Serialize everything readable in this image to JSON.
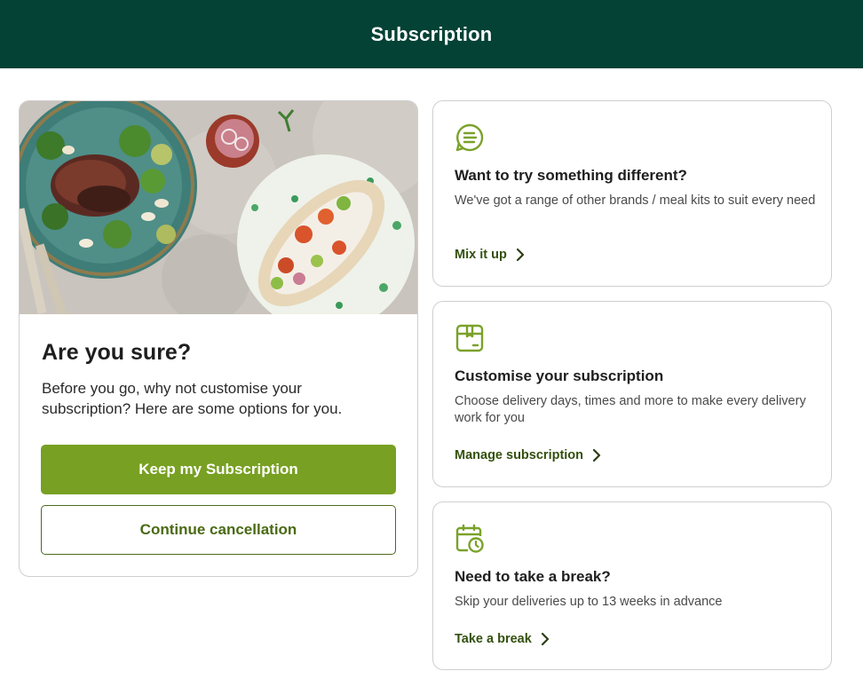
{
  "header": {
    "title": "Subscription"
  },
  "main": {
    "title": "Are you sure?",
    "description": "Before you go, why not customise your subscription? Here are some options for you.",
    "primary_label": "Keep my Subscription",
    "secondary_label": "Continue cancellation"
  },
  "options": [
    {
      "icon": "menu-bubble-icon",
      "title": "Want to try something different?",
      "description": "We've got a range of other brands / meal kits to suit every need",
      "link": "Mix it up"
    },
    {
      "icon": "box-icon",
      "title": "Customise your subscription",
      "description": "Choose delivery days, times and more to make every delivery work for you",
      "link": "Manage subscription"
    },
    {
      "icon": "calendar-clock-icon",
      "title": "Need to take a break?",
      "description": "Skip your deliveries up to 13 weeks in advance",
      "link": "Take a break"
    }
  ],
  "colors": {
    "header_bg": "#034235",
    "accent_green": "#78a022",
    "link_green": "#33500e",
    "icon_green": "#7aa22a"
  }
}
